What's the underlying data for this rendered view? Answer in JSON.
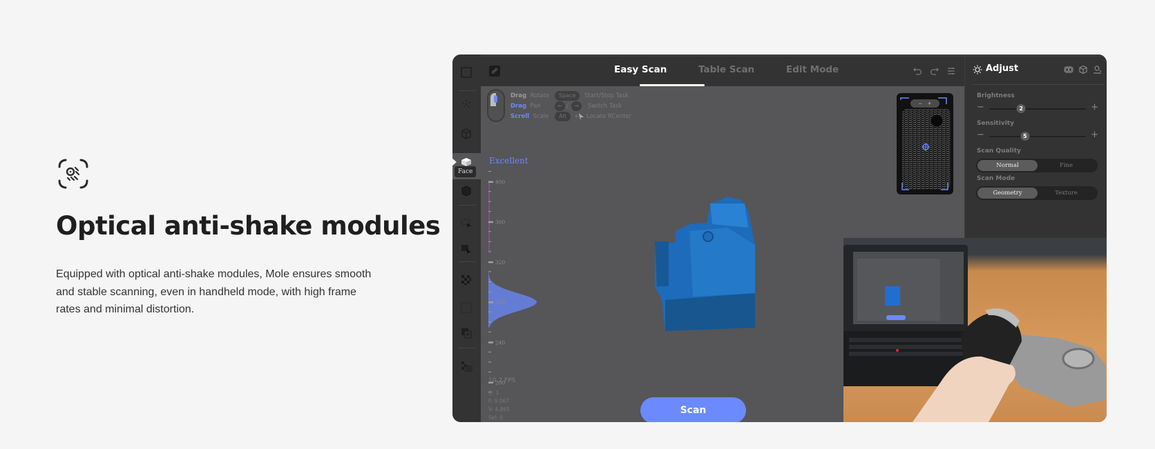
{
  "feature": {
    "icon": "anti-shake-scan-icon",
    "title": "Optical anti-shake modules",
    "description": "Equipped with optical anti-shake modules, Mole ensures smooth and stable scanning, even in handheld mode, with high frame rates and minimal distortion."
  },
  "app": {
    "sidebar": {
      "tooltip": "Face",
      "items": [
        "select-frame-icon",
        "point-cloud-icon",
        "wireframe-cube-icon",
        "face-icon",
        "solid-cube-icon",
        "lasso-select-icon",
        "box-select-icon",
        "checker-icon",
        "dotted-rect-icon",
        "add-layer-icon",
        "camera-texture-icon"
      ]
    },
    "toolbar": {
      "tabs": [
        {
          "label": "Easy Scan",
          "active": true
        },
        {
          "label": "Table Scan",
          "active": false
        },
        {
          "label": "Edit Mode",
          "active": false
        }
      ],
      "actions": [
        "undo-icon",
        "redo-icon",
        "settings-sliders-icon"
      ]
    },
    "hints": {
      "mouse": [
        {
          "action": "Drag",
          "result": "Rotate",
          "highlight": false
        },
        {
          "action": "Drag",
          "result": "Pan",
          "highlight": true
        },
        {
          "action": "Scroll",
          "result": "Scale",
          "highlight": true
        }
      ],
      "keys": [
        {
          "key": "Space",
          "result": "Start/Stop Task"
        },
        {
          "key": "←/→",
          "result": "Switch Task"
        },
        {
          "key": "Alt",
          "result": "Locate RCenter"
        }
      ],
      "sep": "/",
      "plus": "+"
    },
    "quality": {
      "label": "Excellent",
      "scale_ticks": [
        "400",
        "360",
        "320",
        "280",
        "240",
        "200"
      ],
      "distribution_peak": 280,
      "accent": "#6b8afd"
    },
    "stats": {
      "fps": "10.2 FPS",
      "o": "O: 1",
      "f": "F: 9,067",
      "v": "V: 4,865",
      "sel": "Sel: 0"
    },
    "scan_button": "Scan",
    "camera_preview": {
      "zoom_minus": "−",
      "zoom_plus": "+"
    },
    "adjust_panel": {
      "title": "Adjust",
      "header_icons": [
        "texture-toggle-icon",
        "cube-view-icon",
        "user-align-icon"
      ],
      "brightness": {
        "label": "Brightness",
        "value": "2",
        "fraction": 0.33
      },
      "sensitivity": {
        "label": "Sensitivity",
        "value": "5",
        "fraction": 0.37
      },
      "scan_quality": {
        "label": "Scan Quality",
        "options": [
          "Normal",
          "Fine"
        ],
        "selected": "Normal"
      },
      "scan_mode": {
        "label": "Scan Mode",
        "options": [
          "Geometry",
          "Texture"
        ],
        "selected": "Geometry"
      }
    }
  },
  "colors": {
    "accent": "#6b8afd",
    "scan_model": "#1f6fbf",
    "app_bg": "#565558",
    "panel_bg": "#333333"
  }
}
